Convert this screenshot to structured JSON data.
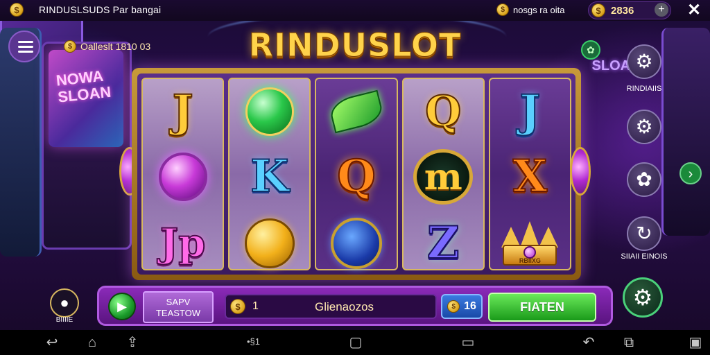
{
  "topbar": {
    "title": "RINDUSLSUDS Par bangai",
    "coin_symbol": "$",
    "news": "nosgs ra oita",
    "balance": "2836",
    "plus": "+",
    "close": "✕"
  },
  "left_info": {
    "jackpot": "Oalleslt 1810 03"
  },
  "logo": "RINDUSLOT",
  "reels": [
    [
      "J",
      "gem-purple",
      "J"
    ],
    [
      "gem-green",
      "K",
      "coin"
    ],
    [
      "leaf",
      "Q",
      "medal-blue"
    ],
    [
      "coin-q",
      "M",
      "Z"
    ],
    [
      "J",
      "X",
      "crown"
    ]
  ],
  "symbol_letters": {
    "r1c1": "J",
    "r1c5": "J",
    "r2c2": "K",
    "r2c3": "Q",
    "r2c4": "m",
    "r2c5": "X",
    "r3c1": "Jp",
    "r3c4": "Z",
    "crown_label": "RBIIXG"
  },
  "controls": {
    "auto_line1": "SAPV",
    "auto_line2": "TEASTOW",
    "bet_coin_value": "1",
    "bet_text": "Glienaozos",
    "lines_value": "16",
    "spin_label": "FIATEN"
  },
  "right_panel": {
    "settings_label": "RINDIAIIS",
    "small_settings_label": "SIIAII EINOIS"
  },
  "avatar_label": "BIIIIE",
  "navbar": {
    "center_text": "•§1"
  }
}
